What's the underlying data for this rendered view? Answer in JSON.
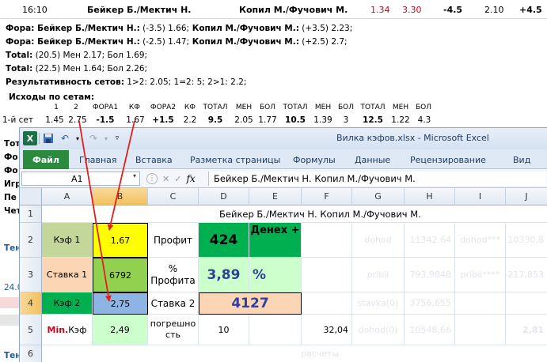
{
  "match": {
    "time": "16:10",
    "player1": "Бейкер Б./Мектич Н.",
    "player2": "Копил М./Фучович М.",
    "odds1": "1.34",
    "odds2": "3.30",
    "handicap1": "-4.5",
    "handicap_odds": "2.10",
    "handicap2": "+4.5"
  },
  "lines": {
    "fora1_label": "Фора: Бейкер Б./Мектич Н.:",
    "fora1_value": " (-3.5) 1.66;",
    "fora1b_label": " Копил М./Фучович М.:",
    "fora1b_value": " (+3.5) 2.23;",
    "fora2_label": "Фора: Бейкер Б./Мектич Н.:",
    "fora2_value": " (-2.5) 1.47;",
    "fora2b_label": " Копил М./Фучович М.:",
    "fora2b_value": " (+2.5) 2.7;",
    "total1_label": "Тotal:",
    "total1_value": " (20.5) Мен 2.17; Бол 1.69;",
    "total2_label": "Тotal:",
    "total2_value": " (22.5) Мен 1.64; Бол 2.26;",
    "sets_label": "Результативность сетов:",
    "sets_value": " 1>2: 2.05; 1=2: 5; 2>1: 2.2;"
  },
  "sets": {
    "title": "Исходы по сетам:",
    "headers": [
      "1",
      "2",
      "ФОРА1",
      "КФ",
      "ФОРА2",
      "КФ",
      "ТОТАЛ",
      "МЕН",
      "БОЛ",
      "ТОТАЛ",
      "МЕН",
      "БОЛ",
      "ТОТАЛ",
      "МЕН",
      "БОЛ"
    ],
    "row_label": "1-й сет",
    "values": [
      "1.45",
      "2.75",
      "-1.5",
      "1.67",
      "+1.5",
      "2.2",
      "9.5",
      "2.05",
      "1.77",
      "10.5",
      "1.39",
      "3",
      "12.5",
      "1.22",
      "4.3"
    ]
  },
  "left_clipped": [
    "Тот",
    "Фо",
    "Фо",
    "Игр",
    "Пе",
    "Чет"
  ],
  "left_misc": [
    "Тен",
    "24.0",
    "Тен"
  ],
  "excel": {
    "window_title": "Вилка кэфов.xlsx  -  Microsoft Excel",
    "tabs": [
      "Файл",
      "Главная",
      "Вставка",
      "Разметка страницы",
      "Формулы",
      "Данные",
      "Рецензирование",
      "Вид"
    ],
    "name_box": "A1",
    "formula": "Бейкер Б./Мектич Н.  Копил М./Фучович М.",
    "columns": [
      "A",
      "B",
      "C",
      "D",
      "E",
      "F",
      "G",
      "H",
      "I",
      "J"
    ],
    "rows": [
      "1",
      "2",
      "3",
      "4",
      "5",
      "6"
    ],
    "cells": {
      "r1_title": "Бейкер Б./Мектич Н.  Копил М./Фучович М.",
      "a2": "Кэф 1",
      "b2": "1,67",
      "c2": "Профит",
      "d2": "424",
      "e2": "Денех +",
      "g2": "dohod",
      "h2": "11342,64",
      "i2": "dohod***",
      "j2": "10330,8",
      "a3": "Ставка 1",
      "b3": "6792",
      "c3": "% Профита",
      "d3": "3,89",
      "e3": "%",
      "g3": "pribil",
      "h3": "793,9848",
      "i3": "pribil****",
      "j3": "-217,853",
      "a4": "Кэф 2",
      "b4": "2,75",
      "c4": "Ставка 2",
      "d4": "4127",
      "g4": "stavka(0)",
      "h4": "3756,655",
      "a5_red": "Min.",
      "a5_rest": " Кэф",
      "b5": "2,49",
      "c5": "погрешность",
      "d5": "10",
      "f5": "32,04",
      "g5": "dohod(0)",
      "h5": "10548,66",
      "j5": "2,81",
      "row6": "расчеты"
    }
  },
  "colors": {
    "title_red": "#d0021b",
    "arrow_red": "#e0201f",
    "yellow": "#ffff00",
    "green_dark": "#00b050",
    "green_mid": "#92d050",
    "green_light": "#ccffcc",
    "blue_cell": "#8db4e2",
    "orange_cell": "#fcd5b4",
    "olive": "#c4d79b",
    "file_tab": "#2a8a3e"
  }
}
